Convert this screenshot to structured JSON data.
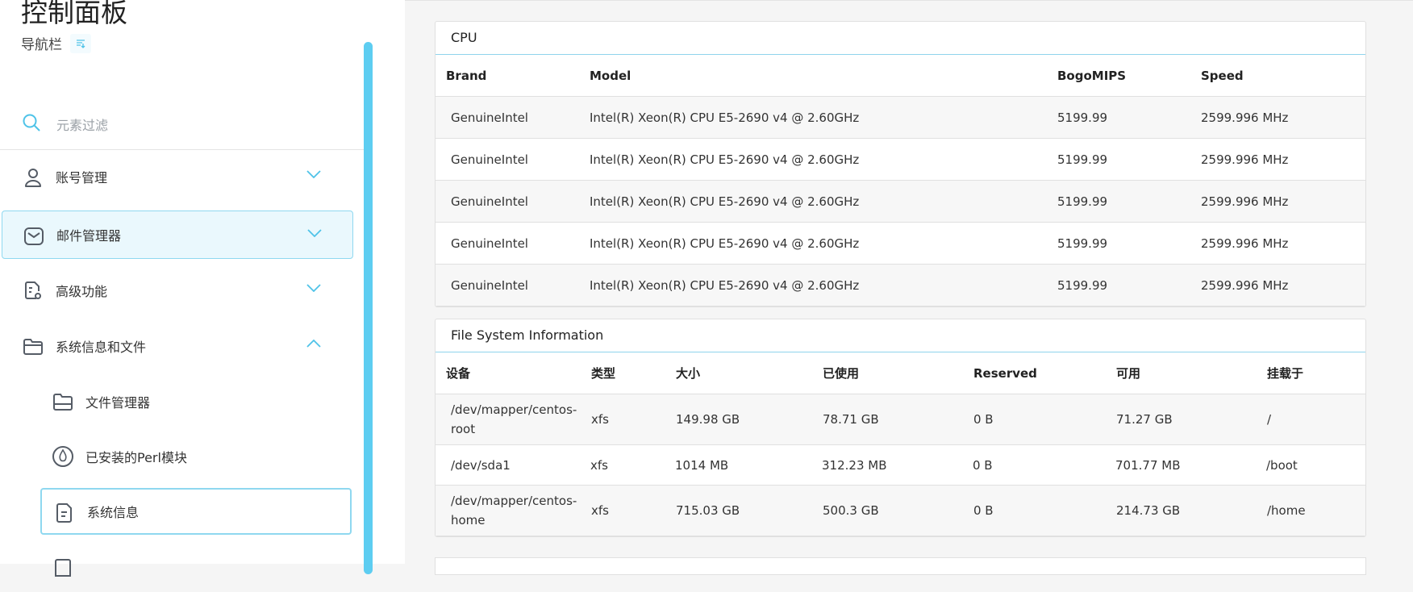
{
  "sidebar": {
    "title": "控制面板",
    "subtitle": "导航栏",
    "toggle_icon": "list-toggle-icon",
    "filter_placeholder": "元素过滤",
    "items": [
      {
        "label": "账号管理",
        "icon": "user-icon",
        "expanded": false
      },
      {
        "label": "邮件管理器",
        "icon": "mail-icon",
        "expanded": false,
        "active": true
      },
      {
        "label": "高级功能",
        "icon": "advanced-settings-icon",
        "expanded": false
      },
      {
        "label": "系统信息和文件",
        "icon": "folder-icon",
        "expanded": true
      }
    ],
    "subitems": [
      {
        "label": "文件管理器",
        "icon": "folder-icon"
      },
      {
        "label": "已安装的Perl模块",
        "icon": "perl-icon"
      },
      {
        "label": "系统信息",
        "icon": "document-icon",
        "active": true
      }
    ]
  },
  "cpu": {
    "title": "CPU",
    "headers": [
      "Brand",
      "Model",
      "BogoMIPS",
      "Speed"
    ],
    "rows": [
      [
        "GenuineIntel",
        "Intel(R) Xeon(R) CPU E5-2690 v4 @ 2.60GHz",
        "5199.99",
        "2599.996 MHz"
      ],
      [
        "GenuineIntel",
        "Intel(R) Xeon(R) CPU E5-2690 v4 @ 2.60GHz",
        "5199.99",
        "2599.996 MHz"
      ],
      [
        "GenuineIntel",
        "Intel(R) Xeon(R) CPU E5-2690 v4 @ 2.60GHz",
        "5199.99",
        "2599.996 MHz"
      ],
      [
        "GenuineIntel",
        "Intel(R) Xeon(R) CPU E5-2690 v4 @ 2.60GHz",
        "5199.99",
        "2599.996 MHz"
      ],
      [
        "GenuineIntel",
        "Intel(R) Xeon(R) CPU E5-2690 v4 @ 2.60GHz",
        "5199.99",
        "2599.996 MHz"
      ]
    ]
  },
  "filesystem": {
    "title": "File System Information",
    "headers": [
      "设备",
      "类型",
      "大小",
      "已使用",
      "Reserved",
      "可用",
      "挂载于"
    ],
    "rows": [
      [
        "/dev/mapper/centos-root",
        "xfs",
        "149.98 GB",
        "78.71 GB",
        "0 B",
        "71.27 GB",
        "/"
      ],
      [
        "/dev/sda1",
        "xfs",
        "1014 MB",
        "312.23 MB",
        "0 B",
        "701.77 MB",
        "/boot"
      ],
      [
        "/dev/mapper/centos-home",
        "xfs",
        "715.03 GB",
        "500.3 GB",
        "0 B",
        "214.73 GB",
        "/home"
      ]
    ]
  },
  "colors": {
    "accent": "#5dcdf1",
    "active_bg": "#eaf8fd",
    "active_border": "#8fd8f0",
    "icon": "#555c66"
  }
}
